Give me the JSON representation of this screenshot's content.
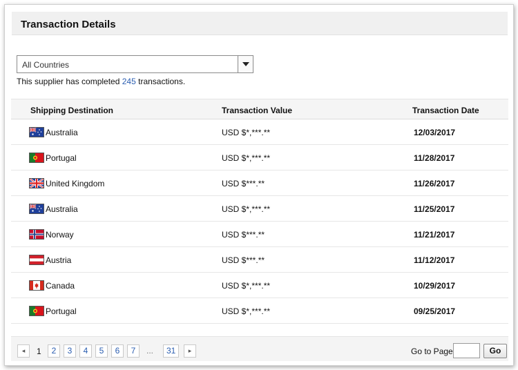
{
  "panel": {
    "title": "Transaction Details"
  },
  "filter": {
    "selected": "All Countries"
  },
  "summary": {
    "prefix": "This supplier has completed ",
    "count": "245",
    "suffix": " transactions."
  },
  "table": {
    "headers": {
      "destination": "Shipping Destination",
      "value": "Transaction Value",
      "date": "Transaction Date"
    },
    "rows": [
      {
        "country": "Australia",
        "flag": "australia-flag-icon",
        "value": "USD $*,***.**",
        "date": "12/03/2017"
      },
      {
        "country": "Portugal",
        "flag": "portugal-flag-icon",
        "value": "USD $*,***.**",
        "date": "11/28/2017"
      },
      {
        "country": "United Kingdom",
        "flag": "uk-flag-icon",
        "value": "USD $***.**",
        "date": "11/26/2017"
      },
      {
        "country": "Australia",
        "flag": "australia-flag-icon",
        "value": "USD $*,***.**",
        "date": "11/25/2017"
      },
      {
        "country": "Norway",
        "flag": "norway-flag-icon",
        "value": "USD $***.**",
        "date": "11/21/2017"
      },
      {
        "country": "Austria",
        "flag": "austria-flag-icon",
        "value": "USD $***.**",
        "date": "11/12/2017"
      },
      {
        "country": "Canada",
        "flag": "canada-flag-icon",
        "value": "USD $*,***.**",
        "date": "10/29/2017"
      },
      {
        "country": "Portugal",
        "flag": "portugal-flag-icon",
        "value": "USD $*,***.**",
        "date": "09/25/2017"
      }
    ]
  },
  "pagination": {
    "prev": "◂",
    "current": "1",
    "pages": [
      "2",
      "3",
      "4",
      "5",
      "6",
      "7"
    ],
    "ellipsis": "...",
    "last": "31",
    "next": "▸",
    "goto_label": "Go to Page",
    "goto_value": "",
    "go_label": "Go"
  }
}
